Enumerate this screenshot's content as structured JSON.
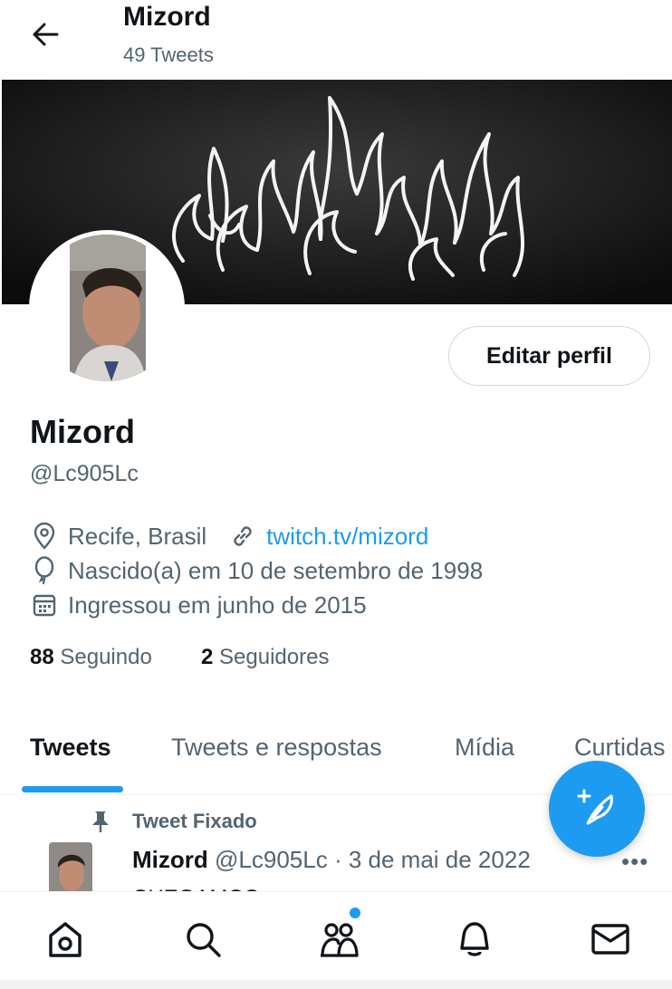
{
  "header": {
    "title": "Mizord",
    "subtitle": "49 Tweets",
    "back_icon": "arrow-left-icon"
  },
  "profile": {
    "edit_label": "Editar perfil",
    "name": "Mizord",
    "handle": "@Lc905Lc",
    "location": "Recife, Brasil",
    "website": "twitch.tv/mizord",
    "birthday": "Nascido(a) em 10 de setembro de 1998",
    "joined": "Ingressou em junho de 2015",
    "following_count": "88",
    "following_label": "Seguindo",
    "followers_count": "2",
    "followers_label": "Seguidores"
  },
  "tabs": [
    {
      "label": "Tweets",
      "active": true
    },
    {
      "label": "Tweets e respostas",
      "active": false
    },
    {
      "label": "Mídia",
      "active": false
    },
    {
      "label": "Curtidas",
      "active": false
    }
  ],
  "pinned_tweet": {
    "pinned_label": "Tweet Fixado",
    "author_name": "Mizord",
    "author_handle": "@Lc905Lc",
    "separator": "·",
    "date": "3 de mai de 2022",
    "more": "•••",
    "text": "CHEGAMOS"
  },
  "nav": {
    "items": [
      "home-icon",
      "search-icon",
      "communities-icon",
      "notifications-icon",
      "messages-icon"
    ]
  },
  "colors": {
    "accent": "#1d9bf0",
    "text_primary": "#0f1419",
    "text_secondary": "#536471"
  }
}
